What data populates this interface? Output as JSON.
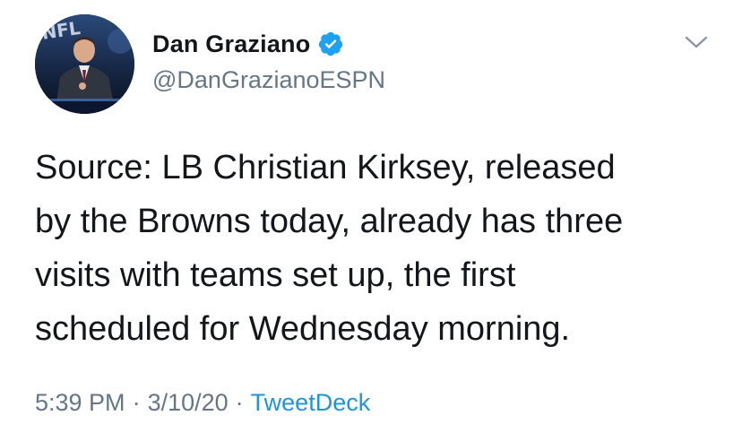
{
  "tweet": {
    "author": {
      "display_name": "Dan Graziano",
      "handle": "@DanGrazianoESPN",
      "verified": true,
      "avatar_icon": "profile-photo"
    },
    "text": "Source: LB Christian Kirksey, released\nby the Browns today, already has three\nvisits with teams set up, the first\nscheduled for Wednesday morning.",
    "time": "5:39 PM",
    "separator": "·",
    "date": "3/10/20",
    "source": "TweetDeck",
    "menu_icon": "chevron-down-icon"
  },
  "colors": {
    "text_primary": "#14171a",
    "text_secondary": "#657786",
    "link": "#1b95e0",
    "verified_badge": "#1da1f2"
  }
}
